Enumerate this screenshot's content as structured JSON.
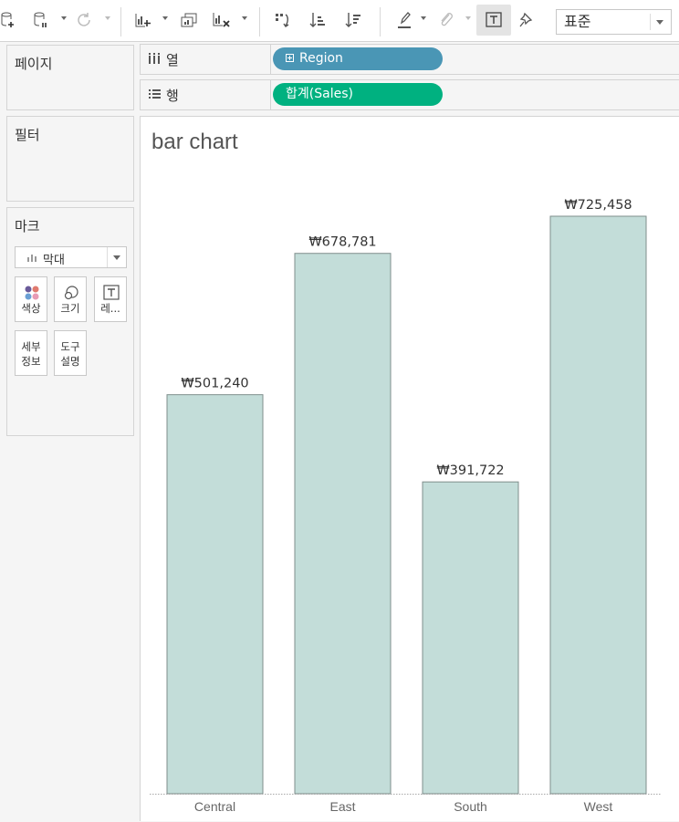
{
  "toolbar": {
    "icons": [
      "new-datasource-icon",
      "pause-updates-icon",
      "refresh-icon",
      "new-worksheet-icon",
      "duplicate-sheet-icon",
      "clear-sheet-icon",
      "swap-axes-icon",
      "sort-ascending-icon",
      "sort-descending-icon",
      "highlight-icon",
      "group-icon",
      "show-labels-icon",
      "pin-icon"
    ],
    "fit_select": "표준"
  },
  "panels": {
    "pages": "페이지",
    "filters": "필터",
    "marks": "마크",
    "mark_type": "막대",
    "cards": {
      "color": "색상",
      "size": "크기",
      "label": "레...",
      "detail_1": "세부",
      "detail_2": "정보",
      "tooltip_1": "도구",
      "tooltip_2": "설명"
    }
  },
  "shelves": {
    "columns_label": "열",
    "columns_pill": "Region",
    "rows_label": "행",
    "rows_pill": "합계(Sales)"
  },
  "view": {
    "title": "bar chart"
  },
  "chart_data": {
    "type": "bar",
    "title": "bar chart",
    "categories": [
      "Central",
      "East",
      "South",
      "West"
    ],
    "values": [
      501240,
      678781,
      391722,
      725458
    ],
    "labels": [
      "₩501,240",
      "₩678,781",
      "₩391,722",
      "₩725,458"
    ],
    "xlabel": "",
    "ylabel": "",
    "ylim": [
      0,
      725458
    ],
    "grid": false,
    "bar_color": "#c3ddd9",
    "bar_border": "#7f8e8c"
  }
}
